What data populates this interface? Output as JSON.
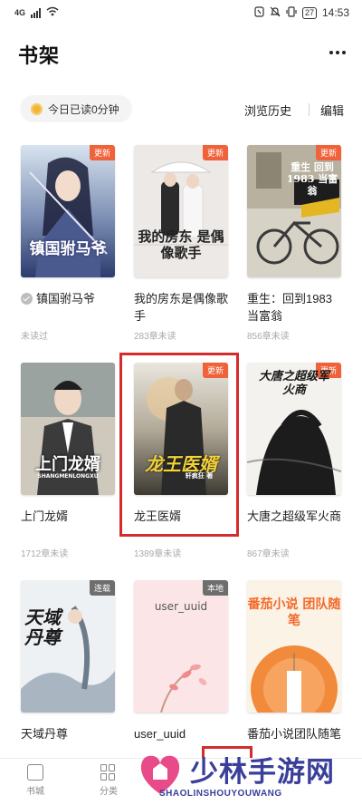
{
  "status_bar": {
    "network": "4G",
    "battery": "27",
    "time": "14:53"
  },
  "header": {
    "title": "书架"
  },
  "reading": {
    "today": "今日已读0分钟"
  },
  "actions": {
    "history": "浏览历史",
    "edit": "编辑"
  },
  "books": [
    {
      "title": "镇国驸马爷",
      "meta": "未读过",
      "tag": "更新",
      "cover_text": "镇国驸马爷"
    },
    {
      "title": "我的房东是偶像歌手",
      "meta": "283章未读",
      "tag": "更新",
      "cover_text": "我的房东 是偶像歌手"
    },
    {
      "title": "重生：回到1983当富翁",
      "meta": "856章未读",
      "tag": "更新",
      "cover_text": "重生 回到1983 当富翁"
    },
    {
      "title": "上门龙婿",
      "meta": "1712章未读",
      "tag": "",
      "cover_text": "上门龙婿",
      "cover_sub": "SHANGMENLONGXU"
    },
    {
      "title": "龙王医婿",
      "meta": "1389章未读",
      "tag": "更新",
      "cover_text": "龙王医婿",
      "cover_author": "轩疯狂 著"
    },
    {
      "title": "大唐之超级军火商",
      "meta": "867章未读",
      "tag": "更新",
      "cover_text": "大唐之超级军火商"
    },
    {
      "title": "天域丹尊",
      "meta": "",
      "tag": "连载",
      "cover_text": "天域丹尊"
    },
    {
      "title": "user_uuid",
      "meta": "",
      "tag": "本地",
      "cover_text": "user_uuid"
    },
    {
      "title": "番茄小说团队随笔",
      "meta": "",
      "tag": "",
      "cover_text": "番茄小说 团队随笔"
    }
  ],
  "bottom_nav": [
    {
      "label": "书城",
      "icon": "home-icon"
    },
    {
      "label": "分类",
      "icon": "grid-icon"
    }
  ],
  "watermark": {
    "title": "少林手游网",
    "subtitle": "SHAOLINSHOUYOUWANG"
  },
  "colors": {
    "highlight": "#d42b2b",
    "update_tag": "#f0623a",
    "watermark": "#3a3f9a"
  }
}
